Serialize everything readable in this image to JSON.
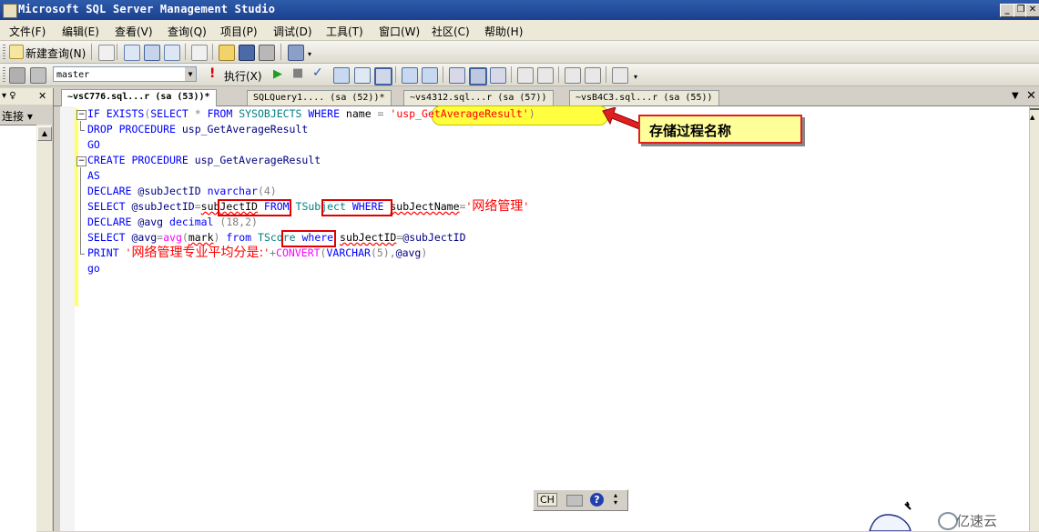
{
  "window": {
    "title": "Microsoft SQL Server Management Studio"
  },
  "menu": [
    "文件(F)",
    "编辑(E)",
    "查看(V)",
    "查询(Q)",
    "项目(P)",
    "调试(D)",
    "工具(T)",
    "窗口(W)",
    "社区(C)",
    "帮助(H)"
  ],
  "toolbar1": {
    "new_query_label": "新建查询(N)"
  },
  "toolbar2": {
    "database": "master",
    "execute_label": "执行(X)"
  },
  "left_panel": {
    "connect_label": "连接 ▾"
  },
  "tabs": [
    {
      "label": "~vsC776.sql...r (sa (53))*",
      "active": true
    },
    {
      "label": "SQLQuery1.... (sa (52))*",
      "active": false
    },
    {
      "label": "~vs4312.sql...r (sa (57))",
      "active": false
    },
    {
      "label": "~vsB4C3.sql...r (sa (55))",
      "active": false
    }
  ],
  "code": {
    "l1": {
      "a": "IF EXISTS",
      "b": "(",
      "c": "SELECT",
      "d": " * ",
      "e": "FROM",
      "f": " SYSOBJECTS ",
      "g": "WHERE",
      "h": " name ",
      "i": "= ",
      "j": "'usp_GetAverageResult'",
      "k": ")"
    },
    "l2": {
      "a": "DROP PROCEDURE",
      "b": " usp_GetAverageResult"
    },
    "l3": {
      "a": "GO"
    },
    "l4": {
      "a": "CREATE PROCEDURE",
      "b": " usp_GetAverageResult"
    },
    "l5": {
      "a": "AS"
    },
    "l6": {
      "a": "DECLARE",
      "b": " @subJectID ",
      "c": "nvarchar",
      "d": "(4)"
    },
    "l7": {
      "a": "SELECT",
      "b": " @subJectID",
      "c": "=",
      "d": "subJectID",
      "e": " FROM ",
      "f": "TSubject",
      "g": " WHERE ",
      "h": "subJectName",
      "i": "=",
      "j": "'",
      "k": "网络管理",
      "l": "'"
    },
    "l8": {
      "a": "DECLARE",
      "b": " @avg ",
      "c": "decimal",
      "d": " (18,2)"
    },
    "l9": {
      "a": "SELECT",
      "b": " @avg",
      "c": "=",
      "d": "avg",
      "e": "(",
      "f": "mark",
      "g": ")",
      "h": " from ",
      "i": "TScore",
      "j": " where ",
      "k": "subJectID",
      "l": "=",
      "m": "@subJectID"
    },
    "l10": {
      "a": "PRINT",
      "b": " '",
      "c": "网络管理专业平均分是:",
      "d": "'",
      "e": "+",
      "f": "CONVERT",
      "g": "(",
      "h": "VARCHAR",
      "i": "(5),",
      "j": "@avg",
      "k": ")"
    },
    "l11": {
      "a": "go"
    }
  },
  "callout": {
    "text": "存储过程名称"
  },
  "langbar": {
    "label": "CH"
  },
  "watermark": {
    "text": "亿速云"
  }
}
